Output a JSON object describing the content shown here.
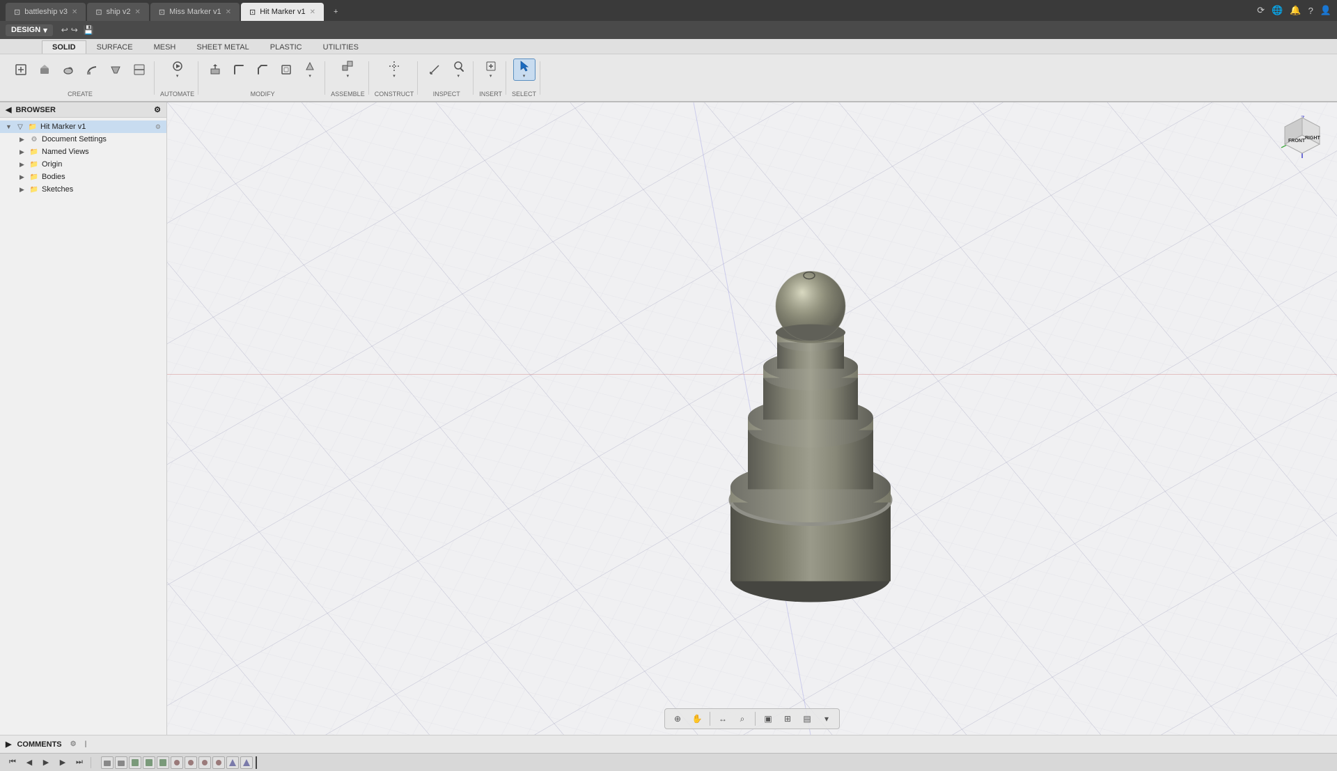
{
  "titlebar": {
    "tabs": [
      {
        "label": "battleship v3",
        "icon": "◻",
        "active": false
      },
      {
        "label": "ship v2",
        "icon": "◻",
        "active": false
      },
      {
        "label": "Miss Marker v1",
        "icon": "◻",
        "active": false
      },
      {
        "label": "Hit Marker v1",
        "icon": "◻",
        "active": true
      }
    ],
    "new_tab_label": "+",
    "icons_right": [
      "⟳",
      "🌐",
      "🔔",
      "?",
      "👤"
    ]
  },
  "design_btn": "DESIGN",
  "toolbar_tabs": [
    "SOLID",
    "SURFACE",
    "MESH",
    "SHEET METAL",
    "PLASTIC",
    "UTILITIES"
  ],
  "active_toolbar_tab": "SOLID",
  "toolbar_groups": [
    {
      "label": "CREATE",
      "tools": [
        {
          "name": "new-body",
          "symbol": "◱",
          "active": false
        },
        {
          "name": "extrude",
          "symbol": "⬡",
          "active": false
        },
        {
          "name": "revolve",
          "symbol": "↻",
          "active": false
        },
        {
          "name": "sweep",
          "symbol": "⌒",
          "active": false
        },
        {
          "name": "loft",
          "symbol": "◊",
          "active": false
        },
        {
          "name": "rib",
          "symbol": "▦",
          "active": false
        }
      ]
    },
    {
      "label": "AUTOMATE",
      "tools": [
        {
          "name": "automate-main",
          "symbol": "⚡",
          "active": false
        }
      ]
    },
    {
      "label": "MODIFY",
      "tools": [
        {
          "name": "press-pull",
          "symbol": "↕",
          "active": false
        },
        {
          "name": "fillet",
          "symbol": "⌣",
          "active": false
        },
        {
          "name": "chamfer",
          "symbol": "◇",
          "active": false
        },
        {
          "name": "shell",
          "symbol": "□",
          "active": false
        },
        {
          "name": "draft",
          "symbol": "⟋",
          "active": false
        }
      ]
    },
    {
      "label": "ASSEMBLE",
      "tools": [
        {
          "name": "assemble-main",
          "symbol": "⊞",
          "active": false
        }
      ]
    },
    {
      "label": "CONSTRUCT",
      "tools": [
        {
          "name": "construct-main",
          "symbol": "✦",
          "active": false
        }
      ]
    },
    {
      "label": "INSPECT",
      "tools": [
        {
          "name": "measure",
          "symbol": "⊥",
          "active": false
        },
        {
          "name": "inspect-main",
          "symbol": "◉",
          "active": false
        }
      ]
    },
    {
      "label": "INSERT",
      "tools": [
        {
          "name": "insert-main",
          "symbol": "⊕",
          "active": false
        }
      ]
    },
    {
      "label": "SELECT",
      "tools": [
        {
          "name": "select-main",
          "symbol": "↖",
          "active": true
        }
      ]
    }
  ],
  "browser": {
    "header": "BROWSER",
    "root_item": "Hit Marker v1",
    "items": [
      {
        "label": "Document Settings",
        "type": "settings",
        "indent": 1,
        "expanded": false
      },
      {
        "label": "Named Views",
        "type": "folder",
        "indent": 1,
        "expanded": false
      },
      {
        "label": "Origin",
        "type": "folder",
        "indent": 1,
        "expanded": false
      },
      {
        "label": "Bodies",
        "type": "folder",
        "indent": 1,
        "expanded": false
      },
      {
        "label": "Sketches",
        "type": "folder",
        "indent": 1,
        "expanded": false
      }
    ]
  },
  "comments": {
    "label": "COMMENTS"
  },
  "timeline": {
    "steps_count": 11
  },
  "viewport_tools": {
    "buttons": [
      "⊕",
      "✋",
      "↔",
      "⌕",
      "▣",
      "⊞",
      "▤"
    ]
  }
}
